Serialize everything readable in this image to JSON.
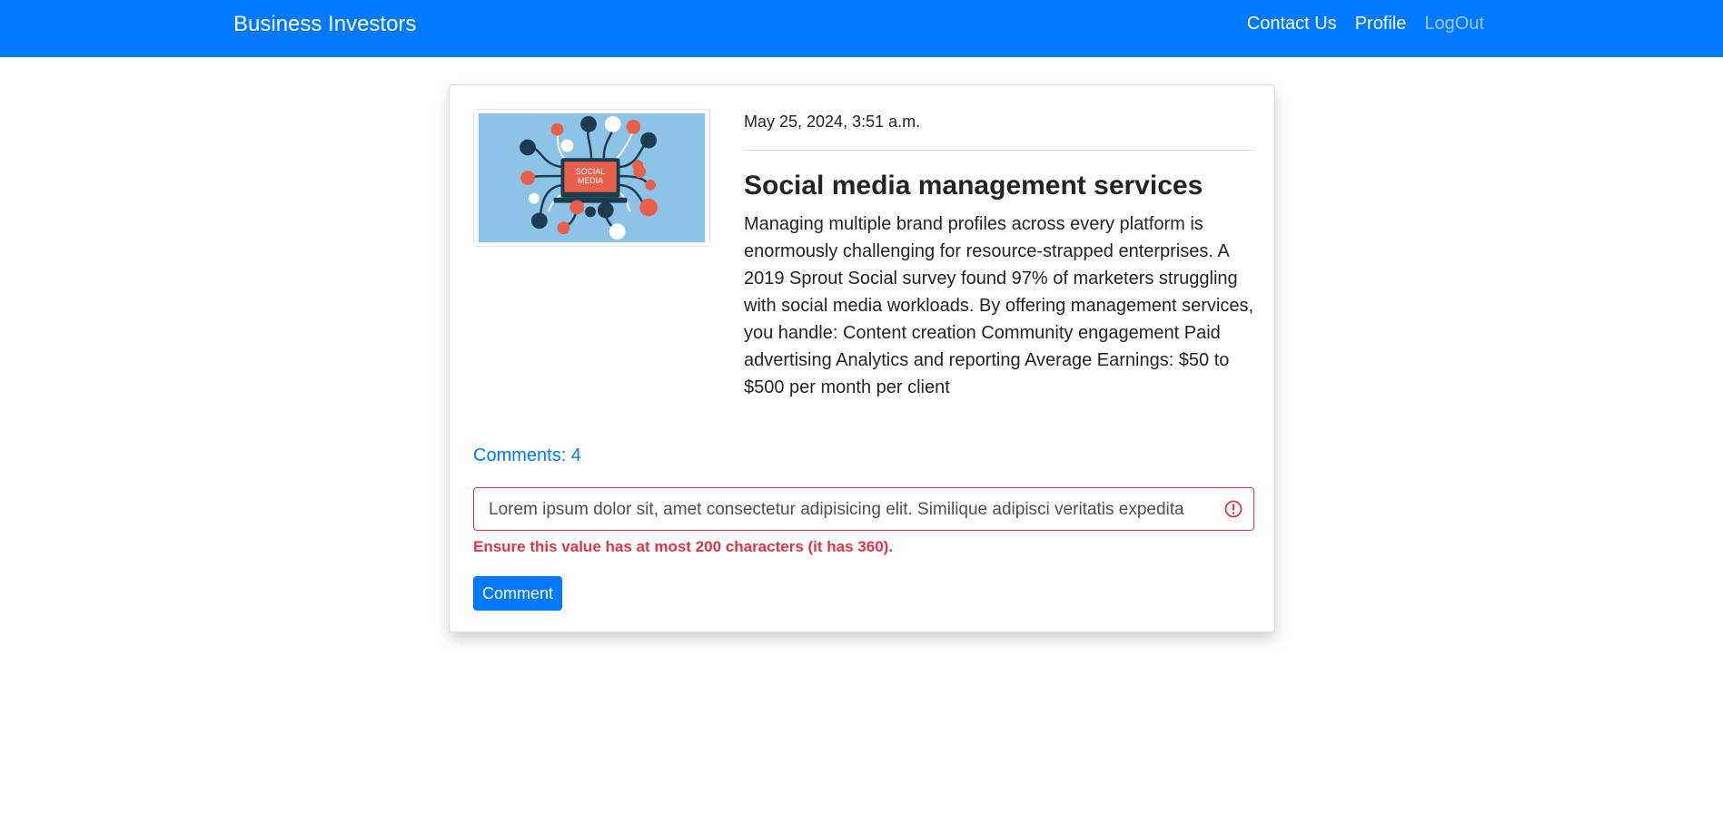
{
  "nav": {
    "brand": "Business Investors",
    "links": [
      {
        "label": "Contact Us"
      },
      {
        "label": "Profile"
      },
      {
        "label": "LogOut"
      }
    ]
  },
  "post": {
    "image_alt": "social-media-illustration",
    "image_text": "SOCIAL MEDIA",
    "date": "May 25, 2024, 3:51 a.m.",
    "title": "Social media management services",
    "description": "Managing multiple brand profiles across every platform is enormously challenging for resource-strapped enterprises. A 2019 Sprout Social survey found 97% of marketers struggling with social media workloads. By offering management services, you handle: Content creation Community engagement Paid advertising Analytics and reporting Average Earnings: $50 to $500 per month per client"
  },
  "comments": {
    "count_label": "Comments: 4",
    "input_value": "Lorem ipsum dolor sit, amet consectetur adipisicing elit. Similique adipisci veritatis expedita",
    "error": "Ensure this value has at most 200 characters (it has 360).",
    "button_label": "Comment"
  },
  "colors": {
    "primary": "#0079fe",
    "danger": "#dc3545"
  }
}
